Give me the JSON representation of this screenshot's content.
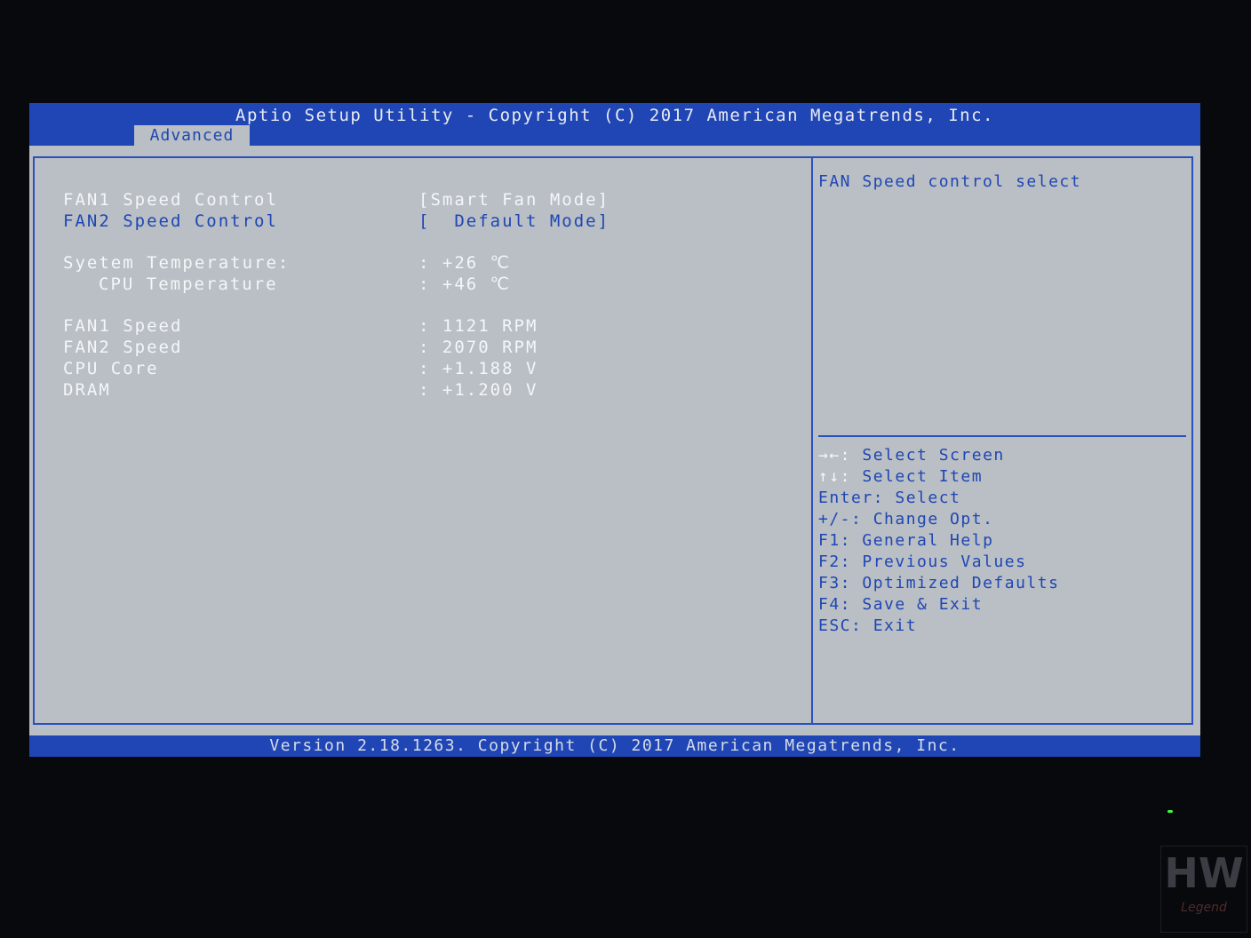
{
  "title_bar": {
    "title": "Aptio Setup Utility - Copyright (C) 2017 American Megatrends, Inc.",
    "active_tab": "Advanced"
  },
  "main": {
    "rows": [
      {
        "label": "FAN1 Speed Control",
        "value": "[Smart Fan Mode]"
      },
      {
        "label": "FAN2 Speed Control",
        "value": "[  Default Mode]"
      },
      {
        "label": "Syetem Temperature:",
        "value": ": +26 ℃"
      },
      {
        "label": "CPU Temperature",
        "value": ": +46 ℃"
      },
      {
        "label": "FAN1 Speed",
        "value": ": 1121 RPM"
      },
      {
        "label": "FAN2 Speed",
        "value": ": 2070 RPM"
      },
      {
        "label": "CPU Core",
        "value": ": +1.188 V"
      },
      {
        "label": "DRAM",
        "value": ": +1.200 V"
      }
    ]
  },
  "help": {
    "description": "FAN Speed control select",
    "keys": [
      {
        "key": "→←:",
        "action": "Select Screen"
      },
      {
        "key": "↑↓:",
        "action": "Select Item"
      },
      {
        "key": "Enter:",
        "action": "Select"
      },
      {
        "key": "+/-:",
        "action": "Change Opt."
      },
      {
        "key": "F1:",
        "action": "General Help"
      },
      {
        "key": "F2:",
        "action": "Previous Values"
      },
      {
        "key": "F3:",
        "action": "Optimized Defaults"
      },
      {
        "key": "F4:",
        "action": "Save & Exit"
      },
      {
        "key": "ESC:",
        "action": "Exit"
      }
    ]
  },
  "footer": {
    "text": "Version 2.18.1263. Copyright (C) 2017 American Megatrends, Inc."
  },
  "watermark": {
    "logo_text": "HW",
    "logo_subtext": "Legend"
  },
  "colors": {
    "bios_blue": "#1f46b4",
    "panel_gray": "#b9bfc4",
    "text_white": "#f4f6f9"
  }
}
